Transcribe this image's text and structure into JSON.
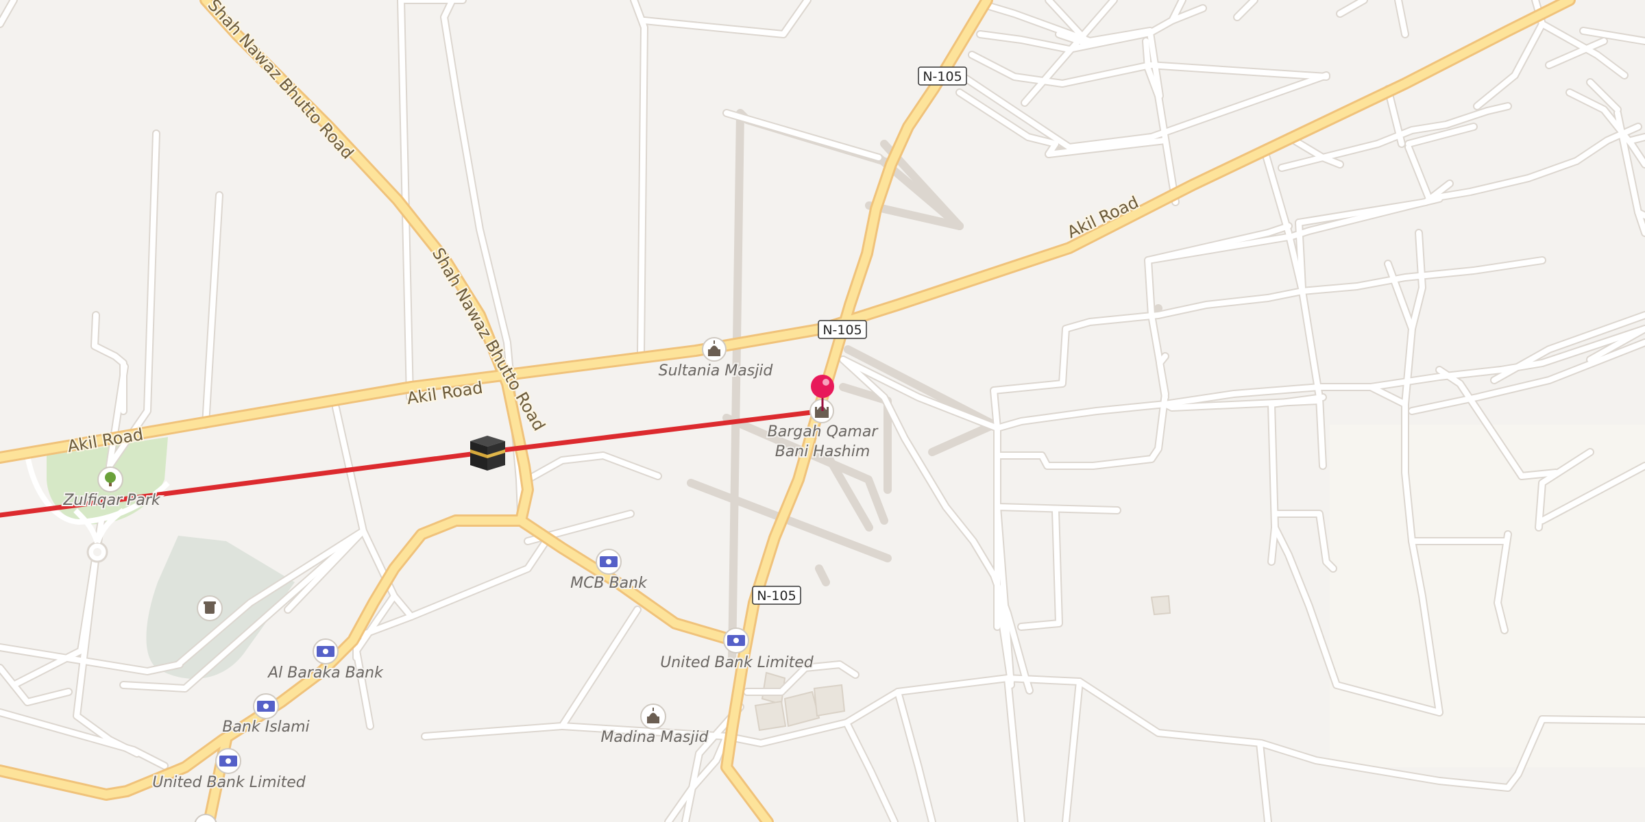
{
  "map": {
    "colors": {
      "background": "#f4f2ef",
      "route_line": "#dc2a2e",
      "marker_pin": "#e8195a",
      "park": "#d6e8c6",
      "cemetery": "#dee3dc",
      "primary_road": "#fde39a",
      "minor_road": "#ffffff"
    },
    "road_labels": {
      "akil_1": "Akil Road",
      "akil_2": "Akil Road",
      "akil_3": "Akil Road",
      "shah_1": "Shah Nawaz Bhutto Road",
      "shah_2": "Shah Nawaz Bhutto Road"
    },
    "shields": {
      "n105_1": "N-105",
      "n105_2": "N-105",
      "n105_3": "N-105"
    },
    "pois": {
      "sultania": {
        "name": "Sultania Masjid",
        "icon": "mosque-icon"
      },
      "bargah_line1": "Bargah Qamar",
      "bargah_line2": "Bani Hashim",
      "bargah_icon": "shrine-icon",
      "zulfiqar": {
        "name": "Zulfiqar Park",
        "icon": "tree-icon"
      },
      "mcb": {
        "name": "MCB Bank",
        "icon": "bank-icon"
      },
      "ubl1": {
        "name": "United Bank Limited",
        "icon": "bank-icon"
      },
      "al_baraka": {
        "name": "Al Baraka Bank",
        "icon": "bank-icon"
      },
      "bank_islami": {
        "name": "Bank Islami",
        "icon": "bank-icon"
      },
      "ubl2": {
        "name": "United Bank Limited",
        "icon": "bank-icon"
      },
      "madina": {
        "name": "Madina Masjid",
        "icon": "mosque-icon"
      },
      "cemetery_icon": "grave-icon",
      "kaaba_icon": "kaaba-icon",
      "destination_icon": "map-pin-icon"
    }
  }
}
